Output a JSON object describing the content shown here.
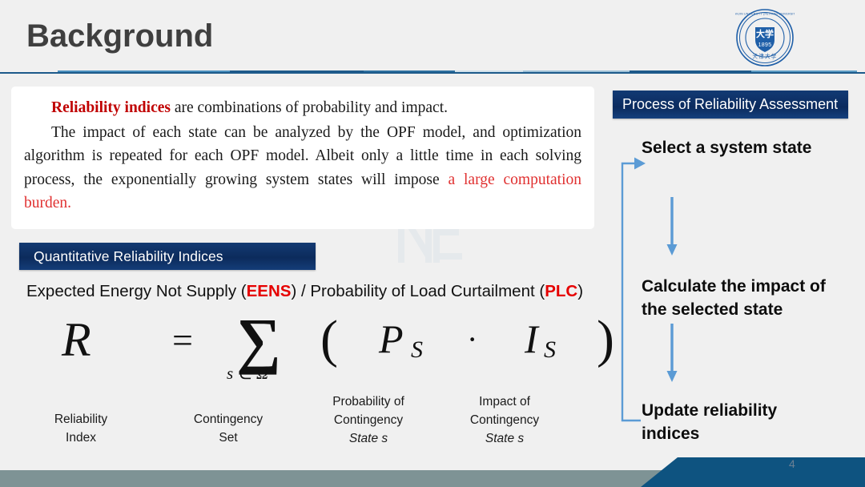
{
  "slide": {
    "title": "Background",
    "page_number": "4",
    "watermark_text": "NE"
  },
  "colors": {
    "background": "#f0f0f0",
    "title_text": "#3f3f3f",
    "header_rule": "#1d5a8a",
    "chip_blue": "#0c2b5c",
    "accent_red": "#c00000",
    "bright_red": "#e60000",
    "arrow_blue": "#5b9bd5",
    "footer_strip": "#7e9395",
    "footer_banner": "#0e5380"
  },
  "seal": {
    "name": "tianjin-university-seal",
    "outer_text": "TIANJIN UNIVERSITY (PEIYANG UNIVERSITY)",
    "year": "1895"
  },
  "text_card": {
    "paragraph1": {
      "lead": "Reliability indices",
      "rest": " are combinations of probability and impact."
    },
    "paragraph2": {
      "body": "The impact of each state can be analyzed by the OPF model, and optimization algorithm is repeated for each OPF model. Albeit only a little time in each solving process, the exponentially growing system states will impose ",
      "highlight": "a large computation burden."
    }
  },
  "chip": {
    "label": "Quantitative Reliability Indices"
  },
  "indices_line": {
    "part1": "Expected Energy Not Supply (",
    "acronym1": "EENS",
    "part2": ") / Probability of Load Curtailment (",
    "acronym2": "PLC",
    "part3": ")"
  },
  "formula": {
    "lhs": "R",
    "equals": "=",
    "sum_symbol": "∑",
    "sum_subscript": "s ∈ Ω",
    "left_paren": "(",
    "prob_symbol": "P",
    "prob_subscript": "S",
    "operator": "·",
    "impact_symbol": "I",
    "impact_subscript": "S",
    "right_paren": ")",
    "captions": [
      {
        "line1": "Reliability",
        "line2": "Index",
        "line3": ""
      },
      {
        "line1": "Contingency",
        "line2": "Set",
        "line3": ""
      },
      {
        "line1": "Probability of",
        "line2": "Contingency",
        "line3": "State s"
      },
      {
        "line1": "Impact of",
        "line2": "Contingency",
        "line3": "State s"
      }
    ]
  },
  "process_panel": {
    "header": "Process of Reliability Assessment",
    "steps": [
      {
        "label": "Select a system state"
      },
      {
        "label": "Calculate the impact of the selected state"
      },
      {
        "label": "Update reliability indices"
      }
    ],
    "arrows": {
      "down_1": "arrow-down-icon",
      "down_2": "arrow-down-icon",
      "feedback": "feedback-loop-arrow-icon"
    }
  }
}
